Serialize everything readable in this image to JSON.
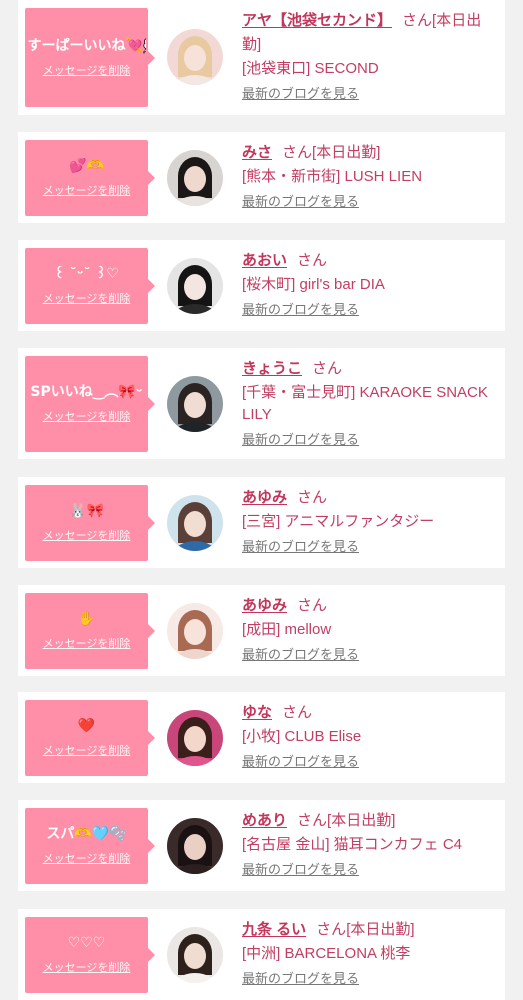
{
  "items": [
    {
      "bubble_message": "すーぱーいいね💘💭..",
      "delete_label": "メッセージを削除",
      "name": "アヤ【池袋セカンド】",
      "honorific": "さん",
      "today_badge": "[本日出勤]",
      "shop": "[池袋東口] SECOND",
      "blog_link": "最新のブログを見る",
      "avatar_colors": {
        "bg": "#f3d9d6",
        "hair": "#e8c9a0",
        "face": "#f6e2d8",
        "cloth": "#f2e7e2"
      }
    },
    {
      "bubble_message": "💕🫶",
      "delete_label": "メッセージを削除",
      "name": "みさ",
      "honorific": "さん",
      "today_badge": "[本日出勤]",
      "shop": "[熊本・新市街] LUSH LIEN",
      "blog_link": "最新のブログを見る",
      "avatar_colors": {
        "bg": "#d8d4d2",
        "hair": "#1c1717",
        "face": "#efd8cd",
        "cloth": "#e9e2de"
      }
    },
    {
      "bubble_message": "꒰ ˘ᵕ˘ ꒱♡",
      "delete_label": "メッセージを削除",
      "name": "あおい",
      "honorific": "さん",
      "today_badge": "",
      "shop": "[桜木町] girl's bar DIA",
      "blog_link": "最新のブログを見る",
      "avatar_colors": {
        "bg": "#e4e4e4",
        "hair": "#141414",
        "face": "#f3e6e2",
        "cloth": "#2a2a2a"
      }
    },
    {
      "bubble_message": "SPいいね‿︵🎀ᵕ",
      "delete_label": "メッセージを削除",
      "name": "きょうこ",
      "honorific": "さん",
      "today_badge": "",
      "shop": "[千葉・富士見町] KARAOKE SNACK LILY",
      "blog_link": "最新のブログを見る",
      "avatar_colors": {
        "bg": "#8f9aa0",
        "hair": "#2b2322",
        "face": "#f0dcd2",
        "cloth": "#1f2428"
      }
    },
    {
      "bubble_message": "🐰🎀",
      "delete_label": "メッセージを削除",
      "name": "あゆみ",
      "honorific": "さん",
      "today_badge": "",
      "shop": "[三宮] アニマルファンタジー",
      "blog_link": "最新のブログを見る",
      "avatar_colors": {
        "bg": "#cfe3ec",
        "hair": "#5a4038",
        "face": "#f2ddd2",
        "cloth": "#2e6aa8"
      }
    },
    {
      "bubble_message": "✋",
      "delete_label": "メッセージを削除",
      "name": "あゆみ",
      "honorific": "さん",
      "today_badge": "",
      "shop": "[成田] mellow",
      "blog_link": "最新のブログを見る",
      "avatar_colors": {
        "bg": "#f6e9e6",
        "hair": "#a86a52",
        "face": "#f7e3da",
        "cloth": "#eed6cf"
      }
    },
    {
      "bubble_message": "❤️",
      "delete_label": "メッセージを削除",
      "name": "ゆな",
      "honorific": "さん",
      "today_badge": "",
      "shop": "[小牧] CLUB Elise",
      "blog_link": "最新のブログを見る",
      "avatar_colors": {
        "bg": "#c8467a",
        "hair": "#3b1f1a",
        "face": "#f3d7cb",
        "cloth": "#e0568c"
      }
    },
    {
      "bubble_message": "スパ🫶🩵🫧",
      "delete_label": "メッセージを削除",
      "name": "めあり",
      "honorific": "さん",
      "today_badge": "[本日出勤]",
      "shop": "[名古屋 金山] 猫耳コンカフェ C4",
      "blog_link": "最新のブログを見る",
      "avatar_colors": {
        "bg": "#3a2a2a",
        "hair": "#1a1212",
        "face": "#e9cfc4",
        "cloth": "#2b1f1f"
      }
    },
    {
      "bubble_message": "♡♡♡",
      "delete_label": "メッセージを削除",
      "name": "九条 るい",
      "honorific": "さん",
      "today_badge": "[本日出勤]",
      "shop": "[中洲] BARCELONA 桃李",
      "blog_link": "最新のブログを見る",
      "avatar_colors": {
        "bg": "#eae7e5",
        "hair": "#2e211c",
        "face": "#f1dcd1",
        "cloth": "#f4f1ef"
      }
    }
  ]
}
